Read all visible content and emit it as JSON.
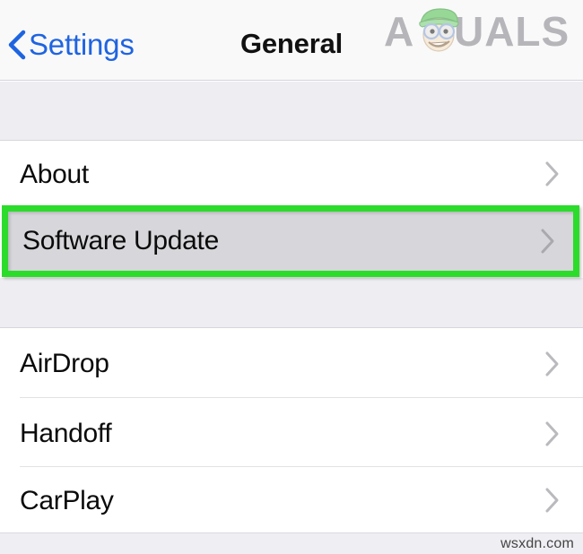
{
  "navbar": {
    "back_label": "Settings",
    "back_icon": "chevron-left-icon",
    "title": "General",
    "back_color": "#1f64e0",
    "title_color": "#111111"
  },
  "logo": {
    "text": "A  PUALS",
    "alt": "appuals-logo",
    "color": "#8e8e93",
    "hat_color": "#5cc45c",
    "face_color": "#f7e3c8",
    "glasses_color": "#8aa8d8"
  },
  "list": {
    "sections": [
      {
        "rows": [
          {
            "label": "About",
            "icon": "chevron-right-icon",
            "highlighted": false
          }
        ]
      },
      {
        "rows": [
          {
            "label": "Software Update",
            "icon": "chevron-right-icon",
            "highlighted": true
          }
        ]
      },
      {
        "rows": [
          {
            "label": "AirDrop",
            "icon": "chevron-right-icon",
            "highlighted": false
          },
          {
            "label": "Handoff",
            "icon": "chevron-right-icon",
            "highlighted": false
          },
          {
            "label": "CarPlay",
            "icon": "chevron-right-icon",
            "highlighted": false
          }
        ]
      }
    ]
  },
  "annotation": {
    "target_label": "Software Update",
    "border_color": "#2bdc2b",
    "fill_color": "#d7d7db"
  },
  "watermark": {
    "site": "wsxdn.com"
  },
  "colors": {
    "background": "#ffffff",
    "group_gap": "#eeeef2",
    "navbar": "#f9f9fa",
    "separator": "#e2e2e6",
    "chevron": "#b9b9be"
  }
}
